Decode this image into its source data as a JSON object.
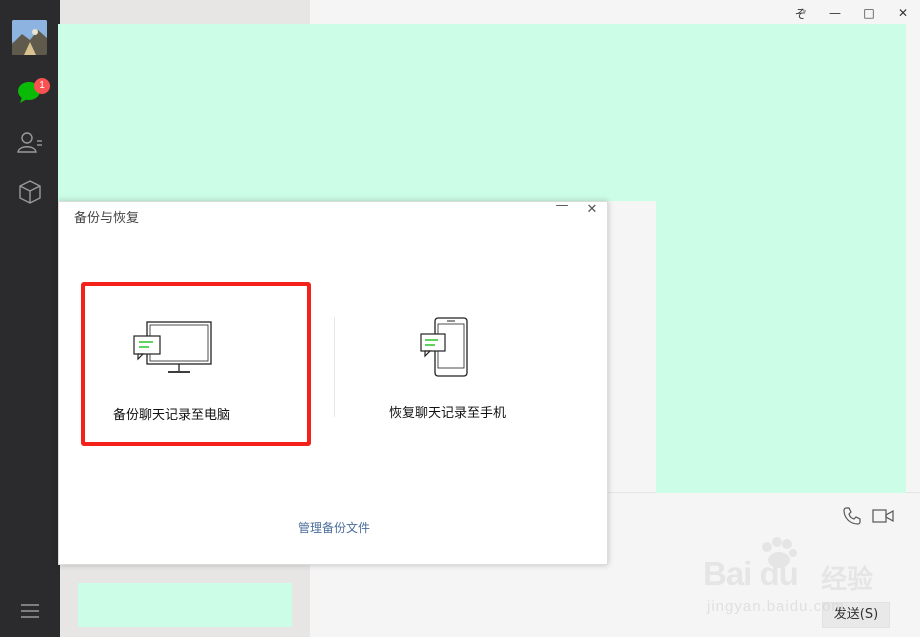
{
  "window": {
    "controls": {
      "pin": "ぞ",
      "minimize": "—",
      "maximize": "□",
      "close": "✕"
    }
  },
  "nav": {
    "chat_badge": "1",
    "icons": [
      "avatar",
      "chat-bubble-icon",
      "contacts-icon",
      "cube-icon",
      "menu-icon"
    ]
  },
  "dialog": {
    "title": "备份与恢复",
    "minimize": "—",
    "close": "✕",
    "backup_label": "备份聊天记录至电脑",
    "restore_label": "恢复聊天记录至手机",
    "manage_link": "管理备份文件"
  },
  "chat": {
    "send_label": "发送(S)"
  },
  "watermark": {
    "brand": "Bai du",
    "jingyan": "经验",
    "url": "jingyan.baidu.com"
  },
  "colors": {
    "nav_bg": "#2b2b2d",
    "accent_green": "#09bb07",
    "badge_red": "#fa5151",
    "highlight_red": "#f5221b",
    "redaction_mint": "#ccfde6",
    "link_blue": "#4a6d9a"
  }
}
